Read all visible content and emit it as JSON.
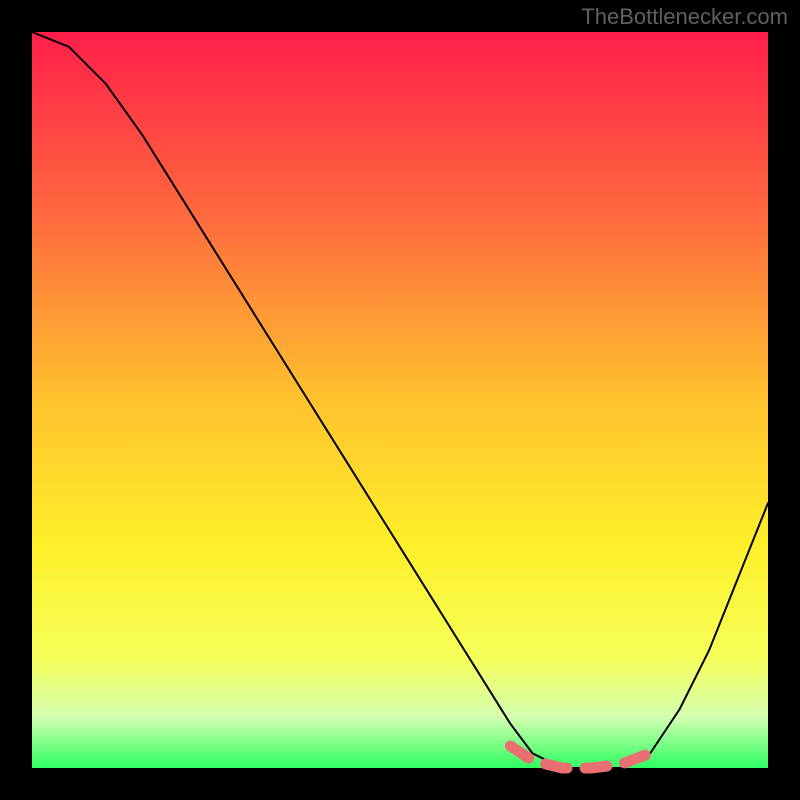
{
  "watermark": "TheBottlenecker.com",
  "chart_data": {
    "type": "line",
    "title": "",
    "xlabel": "",
    "ylabel": "",
    "xlim": [
      0,
      100
    ],
    "ylim": [
      0,
      100
    ],
    "gradient_stops": [
      {
        "offset": 0,
        "color": "#ff1e4a"
      },
      {
        "offset": 25,
        "color": "#ff6a3e"
      },
      {
        "offset": 50,
        "color": "#ffc22e"
      },
      {
        "offset": 70,
        "color": "#fff02a"
      },
      {
        "offset": 85,
        "color": "#f5ff5a"
      },
      {
        "offset": 93,
        "color": "#d5ffb0"
      },
      {
        "offset": 100,
        "color": "#2eff62"
      }
    ],
    "series": [
      {
        "name": "bottleneck-curve",
        "color": "#000000",
        "x": [
          0,
          5,
          10,
          15,
          20,
          25,
          30,
          35,
          40,
          45,
          50,
          55,
          60,
          65,
          68,
          72,
          76,
          80,
          84,
          88,
          92,
          96,
          100
        ],
        "y": [
          100,
          98,
          93,
          86,
          78,
          70,
          62,
          54,
          46,
          38,
          30,
          22,
          14,
          6,
          2,
          0,
          0,
          0,
          2,
          8,
          16,
          26,
          36
        ]
      },
      {
        "name": "optimal-region-marker",
        "color": "#e87070",
        "style": "dashed-thick",
        "x": [
          65,
          68,
          72,
          76,
          80,
          84
        ],
        "y": [
          3,
          1,
          0,
          0,
          0.5,
          2
        ]
      }
    ]
  }
}
